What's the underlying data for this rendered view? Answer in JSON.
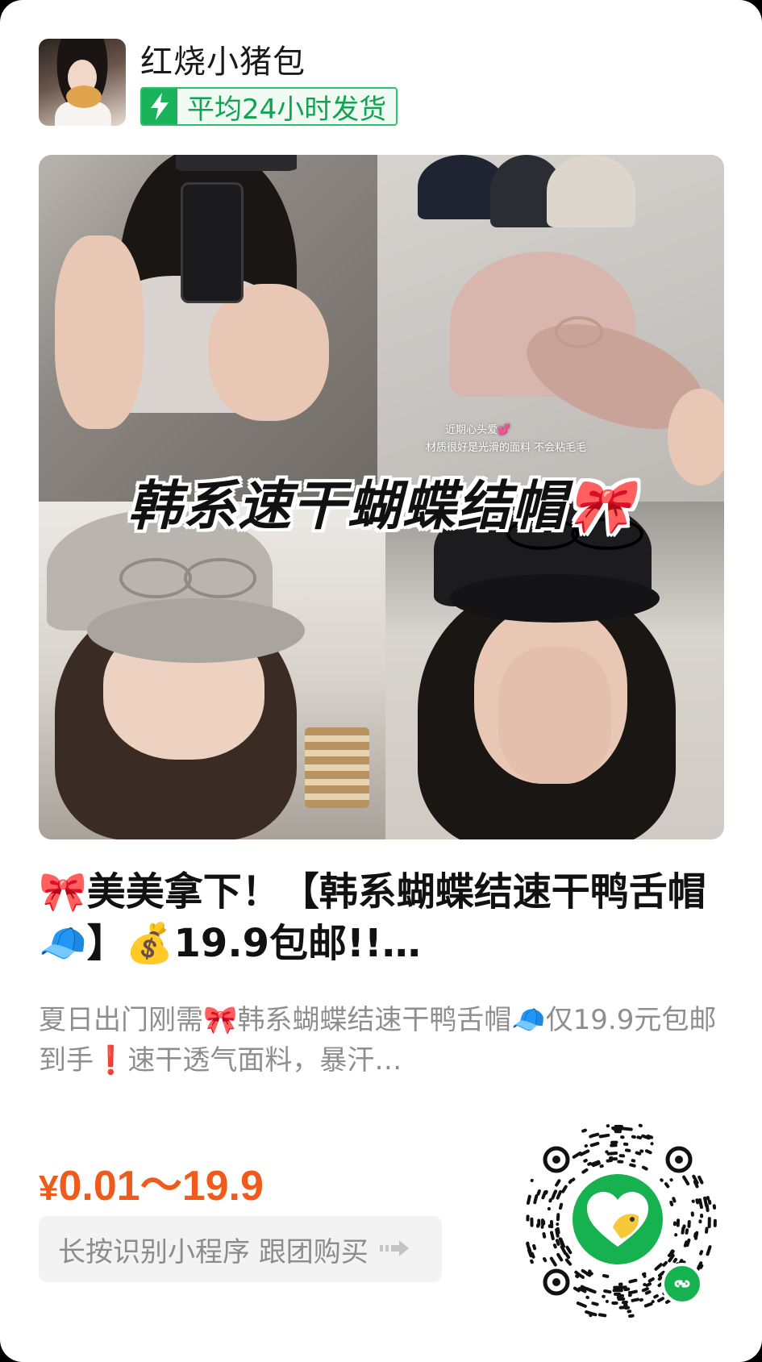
{
  "shop": {
    "name": "红烧小猪包",
    "badge": "平均24小时发货"
  },
  "hero": {
    "title": "韩系速干蝴蝶结帽🎀",
    "note_line1": "近期心头爱💕",
    "note_line2": "材质很好是光滑的面料 不会粘毛毛"
  },
  "product": {
    "title": "🎀美美拿下！【韩系蝴蝶结速干鸭舌帽🧢】💰19.9包邮!!…",
    "description": "夏日出门刚需🎀韩系蝴蝶结速干鸭舌帽🧢仅19.9元包邮到手❗速干透气面料，暴汗…"
  },
  "price": {
    "currency": "¥",
    "range": "0.01～19.9"
  },
  "cta": {
    "label": "长按识别小程序 跟团购买"
  },
  "colors": {
    "accent_green": "#18b35a",
    "price_orange": "#f05a1a"
  },
  "icons": {
    "badge": "lightning-bolt-icon",
    "cta": "arrow-right-icon",
    "qr_center": "mini-program-logo-icon",
    "qr_corner": "mini-program-link-icon"
  }
}
